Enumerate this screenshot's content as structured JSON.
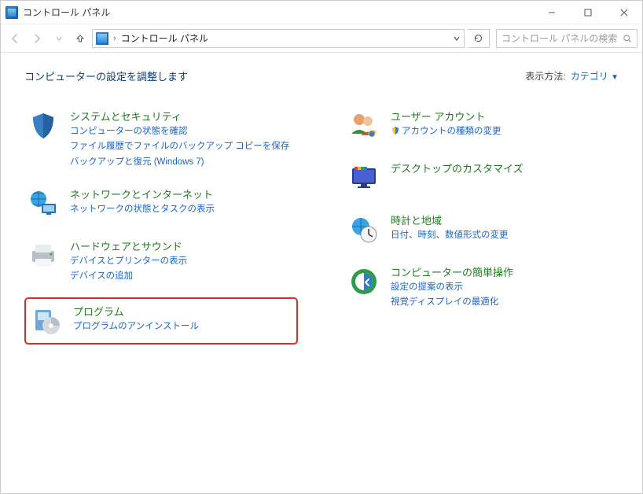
{
  "window": {
    "title": "コントロール パネル"
  },
  "nav": {
    "breadcrumb": "コントロール パネル",
    "search_placeholder": "コントロール パネルの検索"
  },
  "header": {
    "page_title": "コンピューターの設定を調整します",
    "view_by_label": "表示方法:",
    "view_by_value": "カテゴリ"
  },
  "left": [
    {
      "title": "システムとセキュリティ",
      "links": [
        "コンピューターの状態を確認",
        "ファイル履歴でファイルのバックアップ コピーを保存",
        "バックアップと復元 (Windows 7)"
      ]
    },
    {
      "title": "ネットワークとインターネット",
      "links": [
        "ネットワークの状態とタスクの表示"
      ]
    },
    {
      "title": "ハードウェアとサウンド",
      "links": [
        "デバイスとプリンターの表示",
        "デバイスの追加"
      ]
    },
    {
      "title": "プログラム",
      "links": [
        "プログラムのアンインストール"
      ]
    }
  ],
  "right": [
    {
      "title": "ユーザー アカウント",
      "links": [
        "アカウントの種類の変更"
      ]
    },
    {
      "title": "デスクトップのカスタマイズ",
      "links": []
    },
    {
      "title": "時計と地域",
      "links": [
        "日付、時刻、数値形式の変更"
      ]
    },
    {
      "title": "コンピューターの簡単操作",
      "links": [
        "設定の提案の表示",
        "視覚ディスプレイの最適化"
      ]
    }
  ]
}
